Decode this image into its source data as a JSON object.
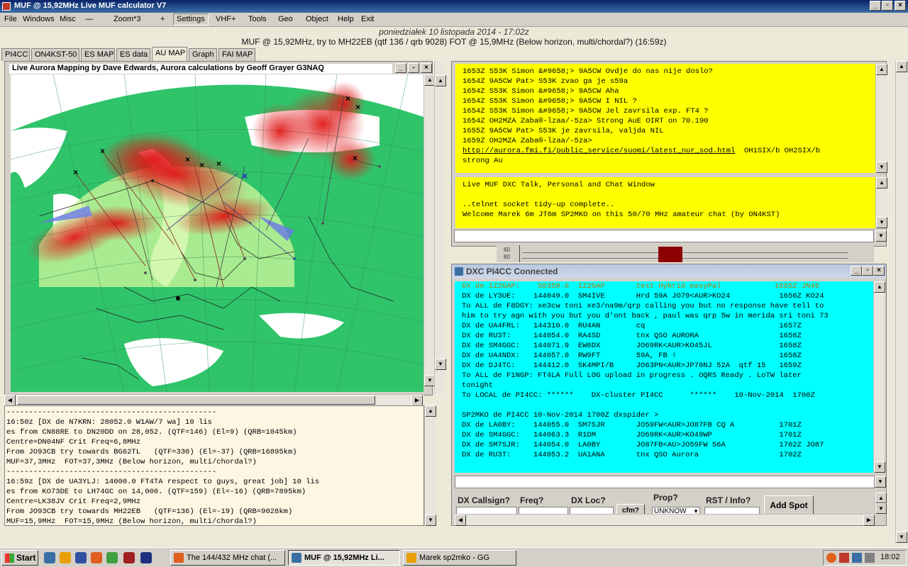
{
  "window": {
    "title": "MUF @ 15,92MHz    Live MUF calculator V7"
  },
  "menu": {
    "items": [
      "File",
      "Windows",
      "Misc",
      "—",
      "Zoom*3",
      "+",
      "Settings",
      "VHF+",
      "Tools",
      "Geo",
      "Object",
      "Help",
      "Exit"
    ]
  },
  "header": {
    "date": "poniedziałek 10 listopada 2014 - 17:02z",
    "muf": "MUF @ 15,92MHz, try to MH22EB (qtf 136 / qrb 9028)     FOT @ 15,9MHz (Below horizon, multi/chordal?) (16:59z)"
  },
  "tabs": [
    "PI4CC",
    "ON4KST-50",
    "ES MAP",
    "ES data",
    "AU MAP",
    "Graph",
    "FAI MAP"
  ],
  "map": {
    "title": "Live Aurora Mapping by Dave Edwards, Aurora calculations by Geoff Grayer G3NAQ",
    "colors": {
      "land": "#33c66b",
      "sea": "#ffffff",
      "aurora": "#e02020",
      "zone": "#c8f59a"
    }
  },
  "log": {
    "lines": [
      "-----------------------------------------------",
      "16:50z [DX de N7KRN: 28052.0 W1AW/7 wa] 10 lis",
      "es from CN88RE to DN20DD on 28,052. (QTF=146) (El=9) (QRB=1045km)",
      "Centre=DN04NF Crit Freq=6,8MHz",
      "From JO93CB try towards BG62TL   (QTF=330) (El=-37) (QRB=16895km)",
      "MUF=37,3MHz  FOT=37,3MHz (Below horizon, multi/chordal?)",
      "-----------------------------------------------",
      "16:59z [DX de UA3YLJ: 14000.0 FT4TA respect to guys, great job] 10 lis",
      "es from KO73DE to LH74GC on 14,000. (QTF=159) (El=-16) (QRB=7895km)",
      "Centre=LK38JV Crit Freq=2,9MHz",
      "From JO93CB try towards MH22EB   (QTF=136) (El=-19) (QRB=9028km)",
      "MUF=15,9MHz  FOT=15,9MHz (Below horizon, multi/chordal?)"
    ]
  },
  "chat_top": {
    "lines": [
      "1653Z S53K Simon &#9658;> 9A5CW Ovdje do nas nije doslo?",
      "1654Z 9A5CW Pat> S53K zvao ga je s59a",
      "1654Z S53K Simon &#9658;> 9A5CW Aha",
      "1654Z S53K Simon &#9658;> 9A5CW I NIL ?",
      "1654Z S53K Simon &#9658;> 9A5CW Jel zavrsila exp. FT4 ?",
      "1654Z OH2MZA Zaba®-lzaa/-5za> Strong AuE OIRT on 70.190",
      "1655Z 9A5CW Pat> S53K je zavrsila, valjda NIL",
      "1659Z OH2MZA Zaba®-lzaa/-5za>"
    ],
    "link": "http://aurora.fmi.fi/public_service/suomi/latest_nur_sod.html",
    "link_after": "  OH1SIX/b OH2SIX/b",
    "last": "strong Au"
  },
  "chat_bottom": {
    "lines": [
      "Live MUF DXC Talk, Personal and Chat Window",
      "",
      "..telnet socket tidy-up complete..",
      "Welcome Marek 6m JT6m SP2MKO on this 50/70 MHz amateur chat (by ON4KST)"
    ]
  },
  "strip": {
    "labels": [
      "60",
      "80"
    ]
  },
  "dxc": {
    "title": "DXC PI4CC Connected",
    "lines_top": [
      [
        "red",
        "DX de IZ2GAP:    50350.0  IZ2GAP       test Hybrid easyPal            1655Z JN45"
      ],
      [
        "",
        "DX de LY3UE:    144049.0  SM4IVE       Hrd 59A JO79<AUR>KO24           1656Z KO24"
      ],
      [
        "",
        "To ALL de F8DGY: xe3cw toni xe3/na9m/qrp calling you but no response have tell to"
      ],
      [
        "",
        "him to try agn with you but you d'ont back , paul was qrp 5w in merida sri toni 73"
      ],
      [
        "",
        "DX de UA4FRL:   144310.0  RU4AN        cq                              1657Z"
      ],
      [
        "",
        "DX de RU3T:     144054.0  RA4SD        tnx QSO AURORA                  1658Z"
      ],
      [
        "",
        "DX de SM4GGC:   144071.9  EW6DX        JO69RK<AUR>KO45JL               1658Z"
      ],
      [
        "",
        "DX de UA4NDX:   144057.0  RW9FT        59A, FB !                       1658Z"
      ],
      [
        "",
        "DX de DJ4TC:    144412.0  SK4MPI/B     JO63PN<AUR>JP70NJ 52A  qtf 15   1659Z"
      ],
      [
        "",
        "To ALL de F1NGP: FT4LA Full LOG upload in progress . OQRS Ready . LoTW later"
      ],
      [
        "",
        "tonight"
      ],
      [
        "",
        "To LOCAL de PI4CC: ******    DX-cluster PI4CC      ******    10-Nov-2014  1700Z"
      ],
      [
        "",
        ""
      ],
      [
        "",
        "SP2MKO de PI4CC 10-Nov-2014 1700Z dxspider >"
      ],
      [
        "",
        "DX de LA0BY:    144055.0  SM7SJR       JO59FW<AUR>JO87FB CQ A          1701Z"
      ],
      [
        "",
        "DX de SM4GGC:   144063.3  R1DM         JO69RK<AUR>KO49WP               1701Z"
      ],
      [
        "",
        "DX de SM7SJR:   144054.0  LA0BY        JO87FB<AU>JO59FW 56A            1702Z JO87"
      ],
      [
        "",
        "DX de RU3T:     144053.2  UA1ANA       tnx QSO Aurora                  1702Z"
      ]
    ],
    "form": {
      "callsign_label": "DX Callsign?",
      "freq_label": "Freq?",
      "loc_label": "DX Loc?",
      "prop_label": "Prop?",
      "prop_value": "UNKNOW",
      "rst_label": "RST / Info?",
      "cfm_label": "cfm?",
      "add_label": "Add Spot"
    }
  },
  "taskbar": {
    "start": "Start",
    "tasks": [
      "The 144/432 MHz chat (...",
      "MUF @ 15,92MHz    Li...",
      "Marek sp2mko - GG"
    ],
    "clock": "18:02"
  }
}
